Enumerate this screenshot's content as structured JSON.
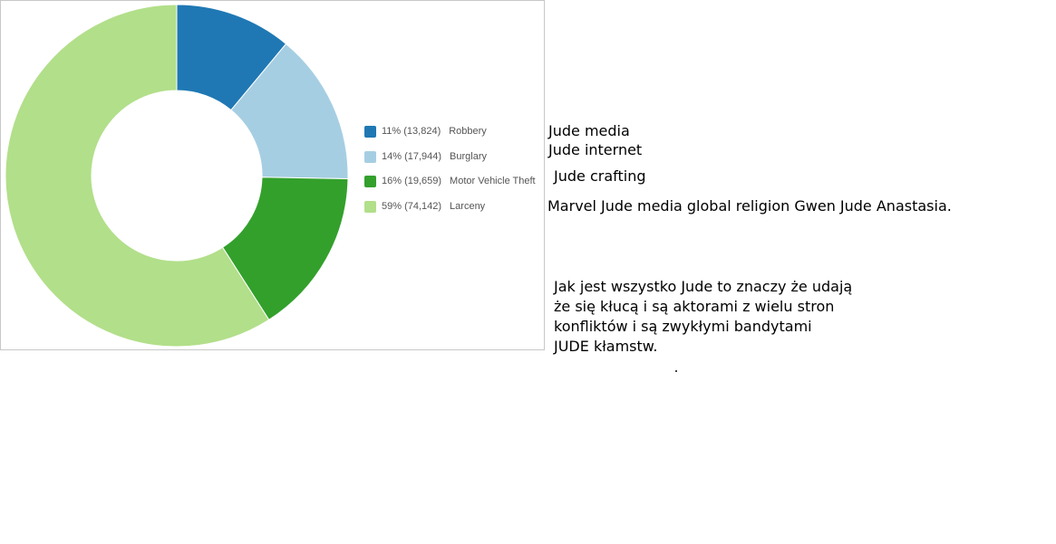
{
  "chart_data": {
    "type": "pie",
    "donut": true,
    "slices": [
      {
        "label": "Robbery",
        "percent_label": "11% (13,824)",
        "value": 13824,
        "color": "#1f78b4"
      },
      {
        "label": "Burglary",
        "percent_label": "14% (17,944)",
        "value": 17944,
        "color": "#a6cee3"
      },
      {
        "label": "Motor Vehicle Theft",
        "percent_label": "16% (19,659)",
        "value": 19659,
        "color": "#33a02c"
      },
      {
        "label": "Larceny",
        "percent_label": "59% (74,142)",
        "value": 74142,
        "color": "#b2df8a"
      }
    ],
    "legend_position": "right"
  },
  "notes": {
    "line1": "Jude media",
    "line2": "Jude internet",
    "line3": "Jude crafting",
    "line4": "Marvel Jude media global religion Gwen Jude Anastasia."
  },
  "paragraph": [
    "Jak jest wszystko Jude to znaczy że udają",
    "że się kłucą i są aktorami z wielu stron",
    "konfliktów i są zwykłymi bandytami",
    "JUDE kłamstw."
  ]
}
